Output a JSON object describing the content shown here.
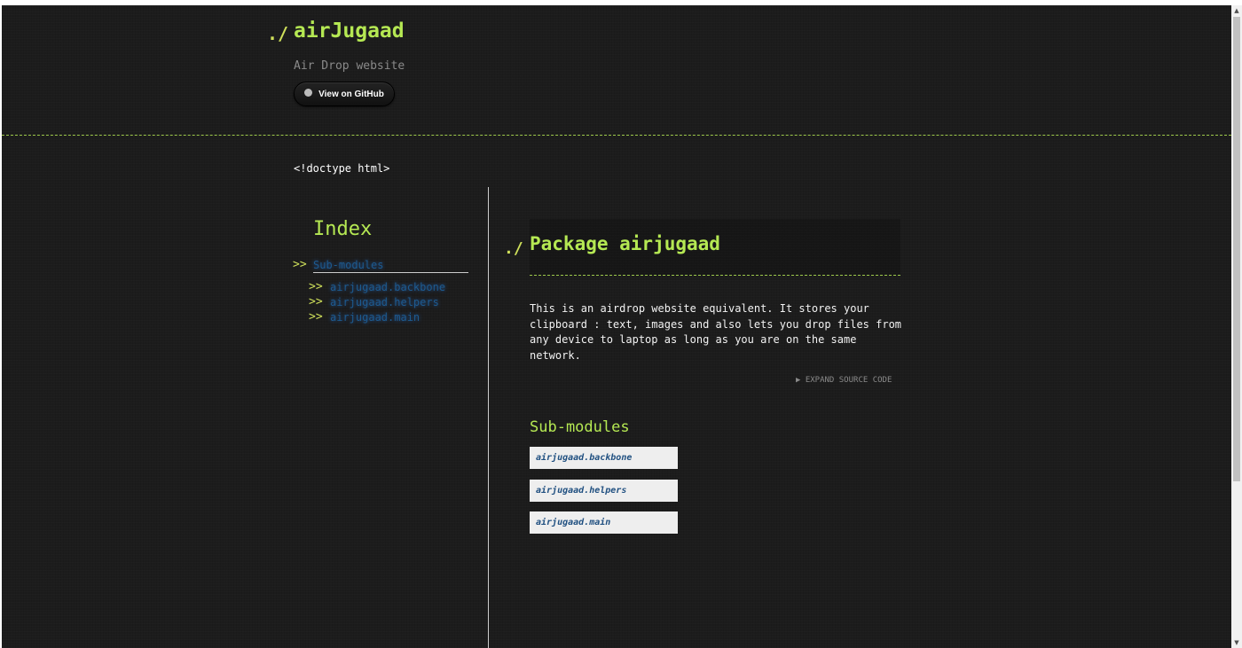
{
  "header": {
    "logo_prefix": "./",
    "logo_name": "airJugaad",
    "tagline": "Air Drop website",
    "github_button_label": "View on GitHub",
    "github_icon": "github-icon"
  },
  "doctype_text": "<!doctype html>",
  "sidebar": {
    "title": "Index",
    "section_arrow": ">>",
    "section_label": "Sub-modules",
    "items": [
      {
        "arrow": ">>",
        "label": "airjugaad.backbone"
      },
      {
        "arrow": ">>",
        "label": "airjugaad.helpers"
      },
      {
        "arrow": ">>",
        "label": "airjugaad.main"
      }
    ]
  },
  "main": {
    "prefix": "./",
    "title": "Package airjugaad",
    "description": "This is an airdrop website equivalent. It stores your\nclipboard : text, images and also lets you drop files from\nany device to laptop as long as you are on the same\nnetwork.",
    "expand_label": "▶  EXPAND SOURCE CODE",
    "submodules_title": "Sub-modules",
    "submodules": [
      {
        "label": "airjugaad.backbone"
      },
      {
        "label": "airjugaad.helpers"
      },
      {
        "label": "airjugaad.main"
      }
    ]
  },
  "colors": {
    "background": "#1c1c1c",
    "accent_green": "#b5e853",
    "link_blue": "#1d5a8f",
    "module_box": "#eeeeee"
  }
}
